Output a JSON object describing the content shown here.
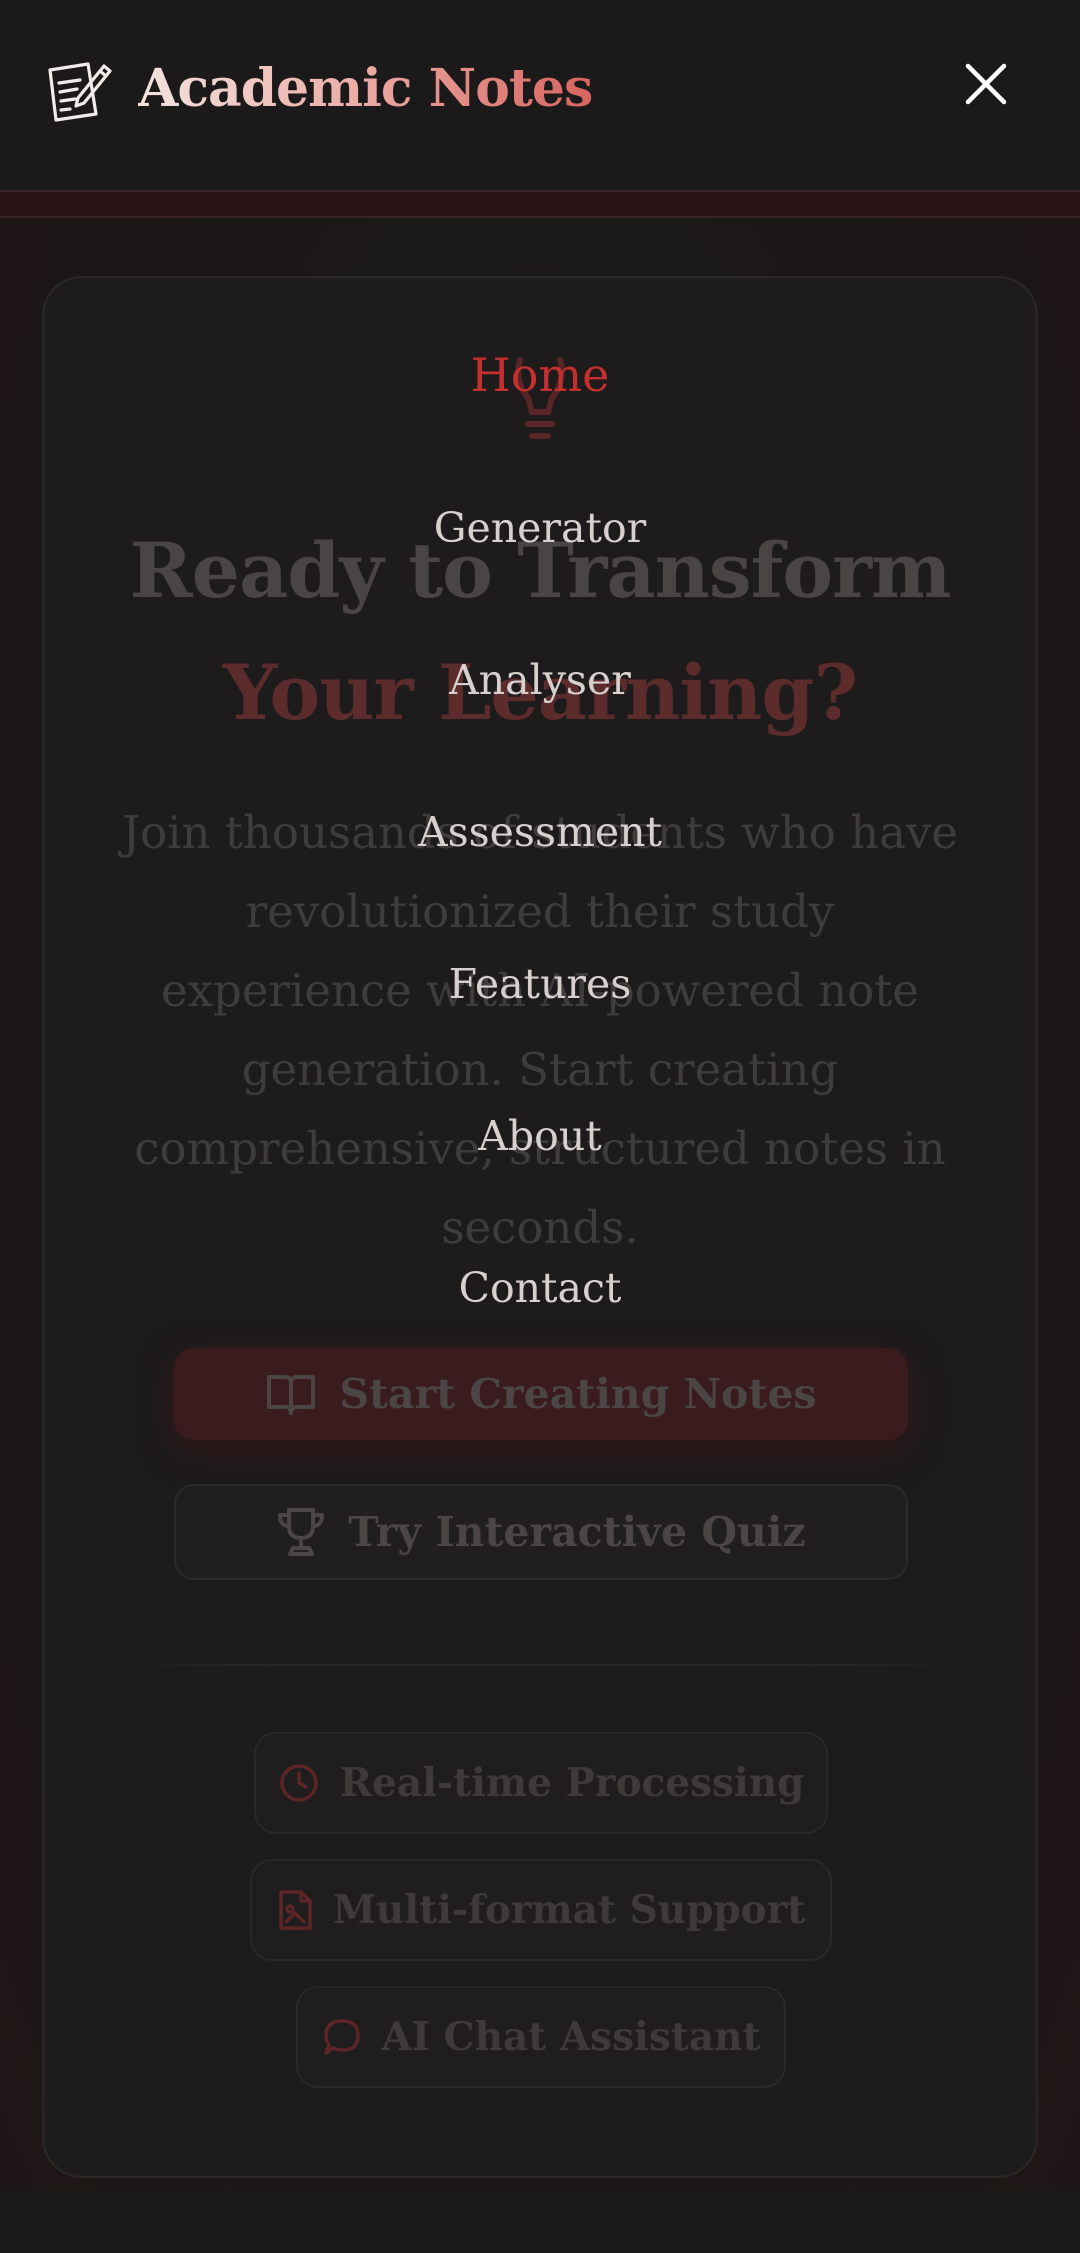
{
  "header": {
    "brand": "Academic Notes",
    "logo_icon": "notes-pen-icon",
    "close_icon": "close-icon"
  },
  "nav": {
    "items": [
      {
        "label": "Home",
        "active": true
      },
      {
        "label": "Generator",
        "active": false
      },
      {
        "label": "Analyser",
        "active": false
      },
      {
        "label": "Assessment",
        "active": false
      },
      {
        "label": "Features",
        "active": false
      },
      {
        "label": "About",
        "active": false
      },
      {
        "label": "Contact",
        "active": false
      }
    ]
  },
  "cta": {
    "icon": "lightbulb-icon",
    "headline_line1": "Ready to Transform",
    "headline_line2": "Your Learning?",
    "subtext": "Join thousands of students who have revolutionized their study experience with AI-powered note generation. Start creating comprehensive, structured notes in seconds.",
    "primary_button": {
      "label": "Start Creating Notes",
      "icon": "book-open-icon"
    },
    "secondary_button": {
      "label": "Try Interactive Quiz",
      "icon": "trophy-icon"
    },
    "features": [
      {
        "label": "Real-time Processing",
        "icon": "clock-icon"
      },
      {
        "label": "Multi-format Support",
        "icon": "file-image-icon"
      },
      {
        "label": "AI Chat Assistant",
        "icon": "chat-bubble-icon"
      }
    ]
  },
  "colors": {
    "background": "#191717",
    "accent": "#c4302d",
    "brand_gradient_start": "#f3e4e0",
    "brand_gradient_end": "#d7645f"
  }
}
